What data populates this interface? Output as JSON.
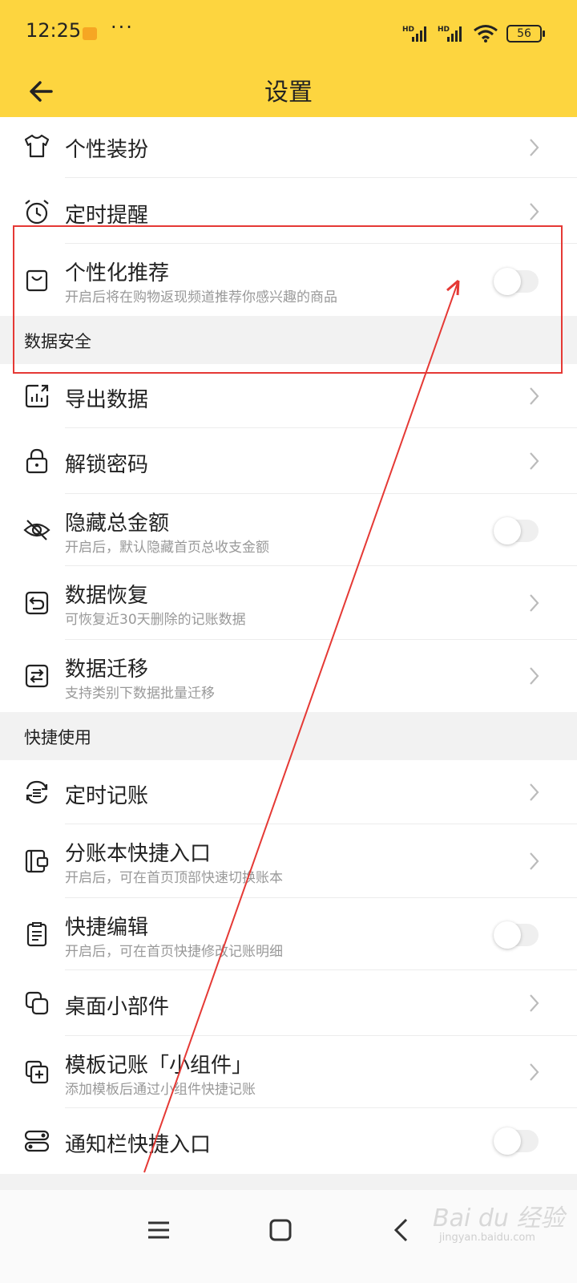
{
  "status_bar": {
    "time": "12:25",
    "dots": "···",
    "battery": "56",
    "signal1": "HD",
    "signal2": "HD"
  },
  "header": {
    "title": "设置"
  },
  "rows": {
    "theme": {
      "label": "个性装扮"
    },
    "reminder": {
      "label": "定时提醒"
    },
    "personalized": {
      "label": "个性化推荐",
      "sub": "开启后将在购物返现频道推荐你感兴趣的商品",
      "enabled": false
    },
    "export": {
      "label": "导出数据"
    },
    "unlock": {
      "label": "解锁密码"
    },
    "hide_amount": {
      "label": "隐藏总金额",
      "sub": "开启后，默认隐藏首页总收支金额",
      "enabled": false
    },
    "restore": {
      "label": "数据恢复",
      "sub": "可恢复近30天删除的记账数据"
    },
    "migrate": {
      "label": "数据迁移",
      "sub": "支持类别下数据批量迁移"
    },
    "scheduled": {
      "label": "定时记账"
    },
    "sub_book": {
      "label": "分账本快捷入口",
      "sub": "开启后，可在首页顶部快速切换账本"
    },
    "quick_edit": {
      "label": "快捷编辑",
      "sub": "开启后，可在首页快捷修改记账明细",
      "enabled": false
    },
    "widget": {
      "label": "桌面小部件"
    },
    "template": {
      "label": "模板记账「小组件」",
      "sub": "添加模板后通过小组件快捷记账"
    },
    "notify": {
      "label": "通知栏快捷入口",
      "enabled": false
    }
  },
  "sections": {
    "data_security": "数据安全",
    "quick_use": "快捷使用"
  },
  "watermark": {
    "main": "Bai du 经验",
    "sub": "jingyan.baidu.com"
  },
  "colors": {
    "accent": "#fdd53f",
    "annotation": "#e53935"
  }
}
